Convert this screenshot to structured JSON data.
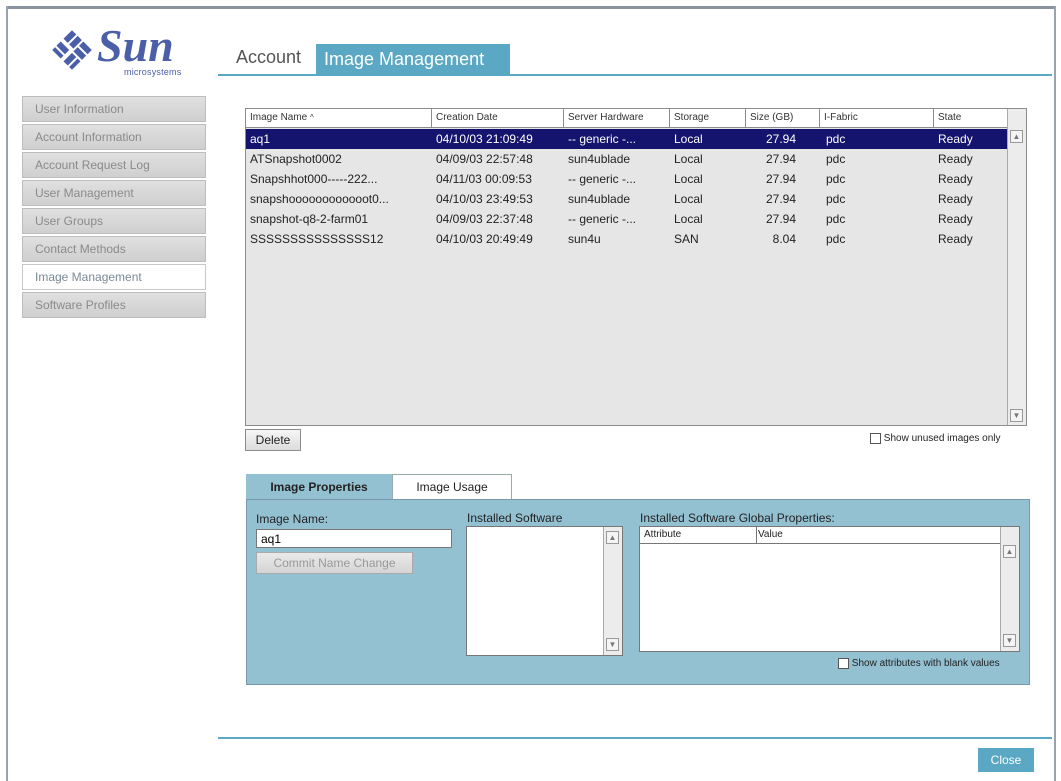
{
  "logo": {
    "brand": "Sun",
    "sub": "microsystems"
  },
  "sidebar": {
    "items": [
      {
        "label": "User Information",
        "active": false
      },
      {
        "label": "Account Information",
        "active": false
      },
      {
        "label": "Account Request Log",
        "active": false
      },
      {
        "label": "User Management",
        "active": false
      },
      {
        "label": "User Groups",
        "active": false
      },
      {
        "label": "Contact Methods",
        "active": false
      },
      {
        "label": "Image Management",
        "active": true
      },
      {
        "label": "Software Profiles",
        "active": false
      }
    ]
  },
  "tabs": {
    "account": "Account",
    "image_management": "Image Management"
  },
  "table": {
    "columns": [
      "Image Name",
      "Creation Date",
      "Server Hardware",
      "Storage",
      "Size (GB)",
      "I-Fabric",
      "State"
    ],
    "sort_marker": "^",
    "rows": [
      {
        "name": "aq1",
        "date": "04/10/03 21:09:49",
        "hardware": "-- generic -...",
        "storage": "Local",
        "size": "27.94",
        "fabric": "pdc",
        "state": "Ready",
        "selected": true
      },
      {
        "name": "ATSnapshot0002",
        "date": "04/09/03 22:57:48",
        "hardware": "sun4ublade",
        "storage": "Local",
        "size": "27.94",
        "fabric": "pdc",
        "state": "Ready",
        "selected": false
      },
      {
        "name": "Snapshhot000-----222...",
        "date": "04/11/03 00:09:53",
        "hardware": "-- generic -...",
        "storage": "Local",
        "size": "27.94",
        "fabric": "pdc",
        "state": "Ready",
        "selected": false
      },
      {
        "name": "snapshoooooooooooot0...",
        "date": "04/10/03 23:49:53",
        "hardware": "sun4ublade",
        "storage": "Local",
        "size": "27.94",
        "fabric": "pdc",
        "state": "Ready",
        "selected": false
      },
      {
        "name": "snapshot-q8-2-farm01",
        "date": "04/09/03 22:37:48",
        "hardware": "-- generic -...",
        "storage": "Local",
        "size": "27.94",
        "fabric": "pdc",
        "state": "Ready",
        "selected": false
      },
      {
        "name": "SSSSSSSSSSSSSSS12",
        "date": "04/10/03 20:49:49",
        "hardware": "sun4u",
        "storage": "SAN",
        "size": "8.04",
        "fabric": "pdc",
        "state": "Ready",
        "selected": false
      }
    ]
  },
  "actions": {
    "delete": "Delete",
    "show_unused": "Show unused images only",
    "close": "Close"
  },
  "properties": {
    "tab_properties": "Image Properties",
    "tab_usage": "Image Usage",
    "image_name_label": "Image Name:",
    "image_name_value": "aq1",
    "commit": "Commit Name Change",
    "installed_software": "Installed Software",
    "global_props": "Installed Software Global Properties:",
    "attr_col": "Attribute",
    "value_col": "Value",
    "show_blank": "Show attributes with blank values"
  },
  "colors": {
    "accent": "#5aa8c4",
    "panel": "#94c1d2",
    "selected_row": "#14146e"
  }
}
